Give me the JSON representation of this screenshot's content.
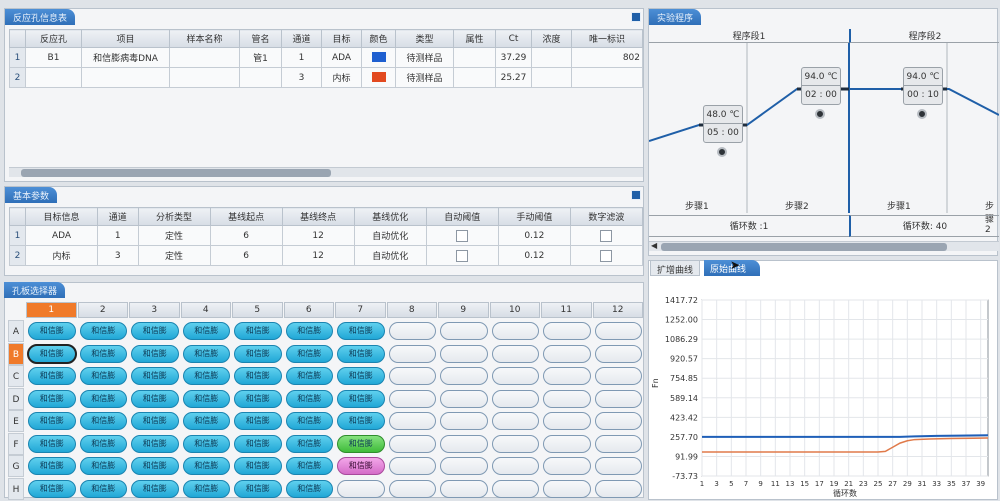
{
  "wells_table": {
    "title": "反应孔信息表",
    "headers": [
      "反应孔",
      "项目",
      "样本名称",
      "管名",
      "通道",
      "目标",
      "颜色",
      "类型",
      "属性",
      "Ct",
      "浓度",
      "唯一标识"
    ],
    "rows": [
      {
        "num": "1",
        "well": "B1",
        "project": "和信膨病毒DNA",
        "sample": "",
        "tube": "管1",
        "channel": "1",
        "target": "ADA",
        "color": "#1e5fd0",
        "type": "待测样品",
        "attr": "",
        "ct": "37.29",
        "conc": "",
        "id": "802"
      },
      {
        "num": "2",
        "well": "",
        "project": "",
        "sample": "",
        "tube": "",
        "channel": "3",
        "target": "内标",
        "color": "#e2491f",
        "type": "待测样品",
        "attr": "",
        "ct": "25.27",
        "conc": "",
        "id": ""
      }
    ]
  },
  "basic_params": {
    "title": "基本参数",
    "headers": [
      "目标信息",
      "通道",
      "分析类型",
      "基线起点",
      "基线终点",
      "基线优化",
      "自动阈值",
      "手动阈值",
      "数字滤波"
    ],
    "rows": [
      {
        "num": "1",
        "target": "ADA",
        "channel": "1",
        "analysis": "定性",
        "start": "6",
        "end": "12",
        "opt": "自动优化",
        "manual": "0.12"
      },
      {
        "num": "2",
        "target": "内标",
        "channel": "3",
        "analysis": "定性",
        "start": "6",
        "end": "12",
        "opt": "自动优化",
        "manual": "0.12"
      }
    ]
  },
  "plate": {
    "title": "孔板选择器",
    "columns": [
      "1",
      "2",
      "3",
      "4",
      "5",
      "6",
      "7",
      "8",
      "9",
      "10",
      "11",
      "12"
    ],
    "rows": [
      "A",
      "B",
      "C",
      "D",
      "E",
      "F",
      "G",
      "H"
    ],
    "well_label": "和信膨",
    "selected_column": "1",
    "selected_row": "B"
  },
  "program": {
    "title": "实验程序",
    "segment1": "程序段1",
    "segment2": "程序段2",
    "steps": [
      {
        "temp": "48.0 ℃",
        "time": "05 : 00",
        "label": "步骤1"
      },
      {
        "temp": "94.0 ℃",
        "time": "02 : 00",
        "label": "步骤2"
      },
      {
        "temp": "94.0 ℃",
        "time": "00 : 10",
        "label": "步骤1"
      },
      {
        "label": "步骤2"
      }
    ],
    "cycle1": "循环数 :1",
    "cycle2": "循环数: 40"
  },
  "chart_tabs": [
    "扩增曲线",
    "原始曲线"
  ],
  "chart_data": {
    "type": "line",
    "title": "",
    "xlabel": "循环数",
    "ylabel": "Fn",
    "yticks": [
      "1417.72",
      "1252.00",
      "1086.29",
      "920.57",
      "754.85",
      "589.14",
      "423.42",
      "257.70",
      "91.99",
      "-73.73"
    ],
    "xticks": [
      "1",
      "3",
      "5",
      "7",
      "9",
      "11",
      "13",
      "15",
      "17",
      "19",
      "21",
      "23",
      "25",
      "27",
      "29",
      "31",
      "33",
      "35",
      "37",
      "39"
    ],
    "ylim": [
      -73.73,
      1417.72
    ],
    "xlim": [
      1,
      40
    ],
    "series": [
      {
        "color": "#1f5fb8",
        "x": [
          1,
          5,
          10,
          15,
          20,
          25,
          28,
          30,
          33,
          36,
          40
        ],
        "y": [
          257.7,
          257.7,
          257.7,
          257.7,
          257.7,
          257.7,
          257.7,
          262,
          266,
          268,
          272
        ]
      },
      {
        "color": "#e07a4a",
        "x": [
          1,
          5,
          10,
          15,
          20,
          25,
          26,
          27,
          28,
          29,
          30,
          32,
          35,
          38,
          40
        ],
        "y": [
          130,
          130,
          130,
          130,
          130,
          130,
          135,
          170,
          205,
          225,
          235,
          240,
          244,
          246,
          248
        ]
      }
    ]
  }
}
